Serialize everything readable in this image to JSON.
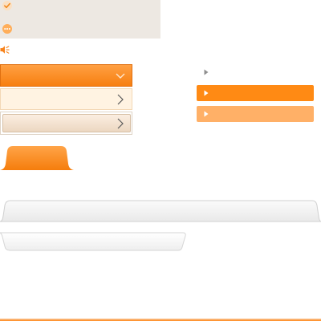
{
  "icons": {
    "check": "check-circle-icon",
    "more": "ellipsis-circle-icon",
    "speaker": "speaker-mute-icon",
    "chevron_down": "chevron-down-icon",
    "chevron_right": "chevron-right-icon",
    "arrow_right": "triangle-right-icon"
  },
  "colors": {
    "accent": "#f77f10",
    "accent_light": "#ffb067",
    "panel_bg": "#ede8e2",
    "bar_light_bg": "#fff3e2"
  }
}
